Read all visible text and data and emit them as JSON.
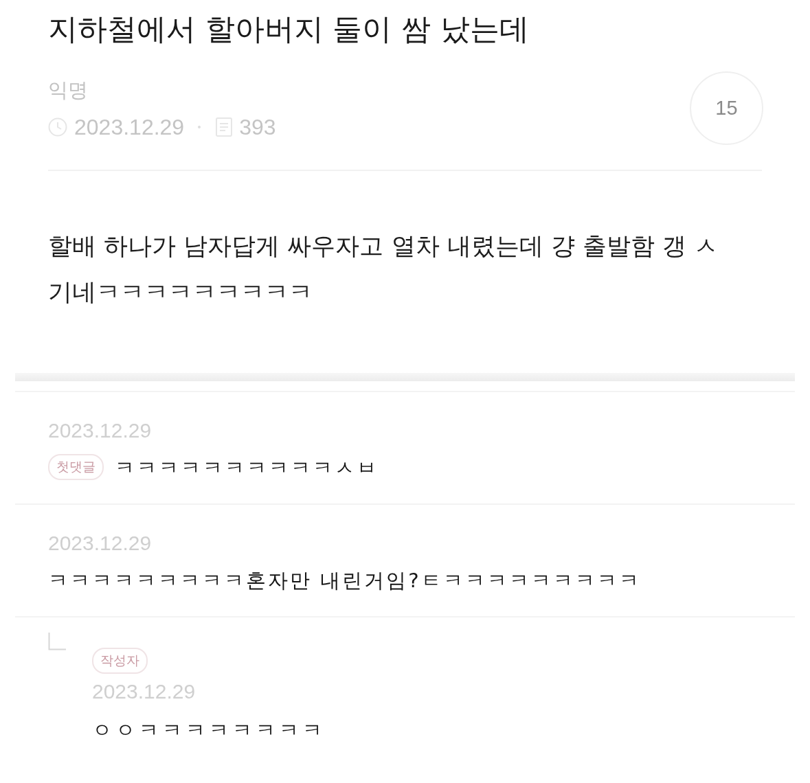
{
  "post": {
    "title": "지하철에서 할아버지 둘이 쌈 났는데",
    "author": "익명",
    "date": "2023.12.29",
    "views": "393",
    "comment_count": "15",
    "body": "할배 하나가 남자답게 싸우자고 열차 내렸는데 걍 출발함 갱 ㅅ기네ㅋㅋㅋㅋㅋㅋㅋㅋㅋ"
  },
  "comments": [
    {
      "kind": "comment",
      "date": "2023.12.29",
      "badge": "첫댓글",
      "text": "ㅋㅋㅋㅋㅋㅋㅋㅋㅋㅋㅅㅂ"
    },
    {
      "kind": "comment",
      "date": "2023.12.29",
      "text": "ㅋㅋㅋㅋㅋㅋㅋㅋㅋ혼자만 내린거임?ㅌㅋㅋㅋㅋㅋㅋㅋㅋㅋ"
    },
    {
      "kind": "reply",
      "badge": "작성자",
      "date": "2023.12.29",
      "text": "ㅇㅇㅋㅋㅋㅋㅋㅋㅋㅋ"
    }
  ]
}
